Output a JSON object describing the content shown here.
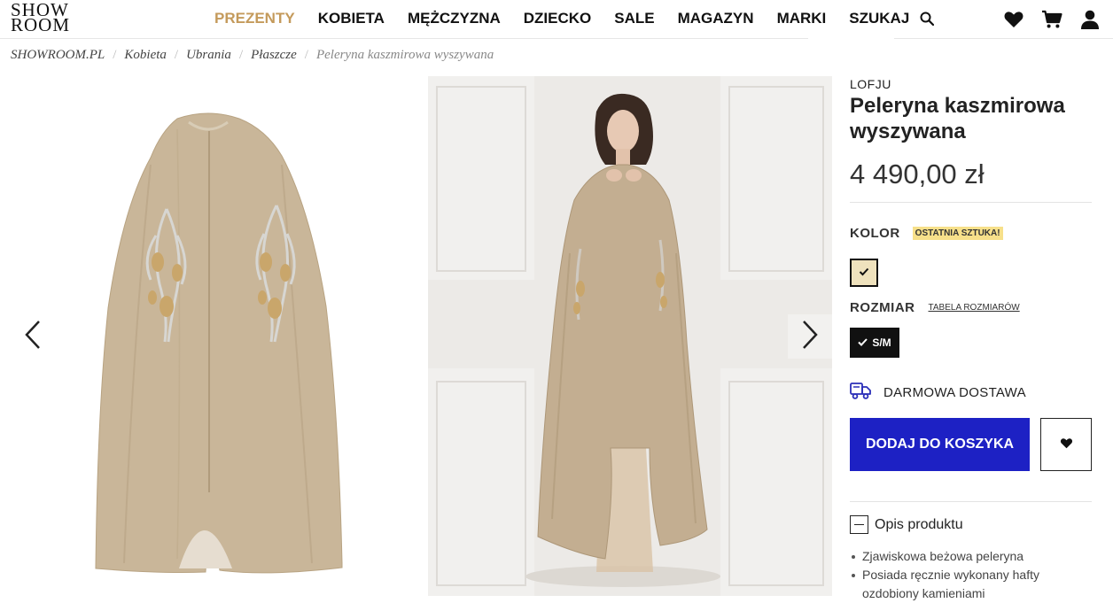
{
  "logo": {
    "line1": "SHOW",
    "line2": "ROOM"
  },
  "nav": {
    "items": [
      "PREZENTY",
      "KOBIETA",
      "MĘŻCZYZNA",
      "DZIECKO",
      "SALE",
      "MAGAZYN",
      "MARKI"
    ],
    "search_label": "SZUKAJ",
    "accent_color": "#c49a5b"
  },
  "header_icons": [
    "heart-icon",
    "cart-icon",
    "user-icon"
  ],
  "breadcrumb": [
    "SHOWROOM.PL",
    "Kobieta",
    "Ubrania",
    "Płaszcze",
    "Peleryna kaszmirowa wyszywana"
  ],
  "gallery": {
    "images": [
      "cape-flat-lay",
      "cape-on-model"
    ]
  },
  "product": {
    "brand": "LOFJU",
    "title": "Peleryna kaszmirowa wyszywana",
    "price": "4 490,00 zł",
    "color_label": "KOLOR",
    "last_item_badge": "OSTATNIA SZTUKA!",
    "selected_color": "#efe2bd",
    "size_label": "ROZMIAR",
    "size_chart_link": "TABELA ROZMIARÓW",
    "selected_size": "S/M",
    "shipping_label": "DARMOWA DOSTAWA",
    "add_to_cart": "DODAJ DO KOSZYKA",
    "cart_button_color": "#1d21c4",
    "description_label": "Opis produktu",
    "description_items": [
      "Zjawiskowa beżowa peleryna",
      "Posiada ręcznie wykonany hafty ozdobiony kamieniami"
    ]
  }
}
